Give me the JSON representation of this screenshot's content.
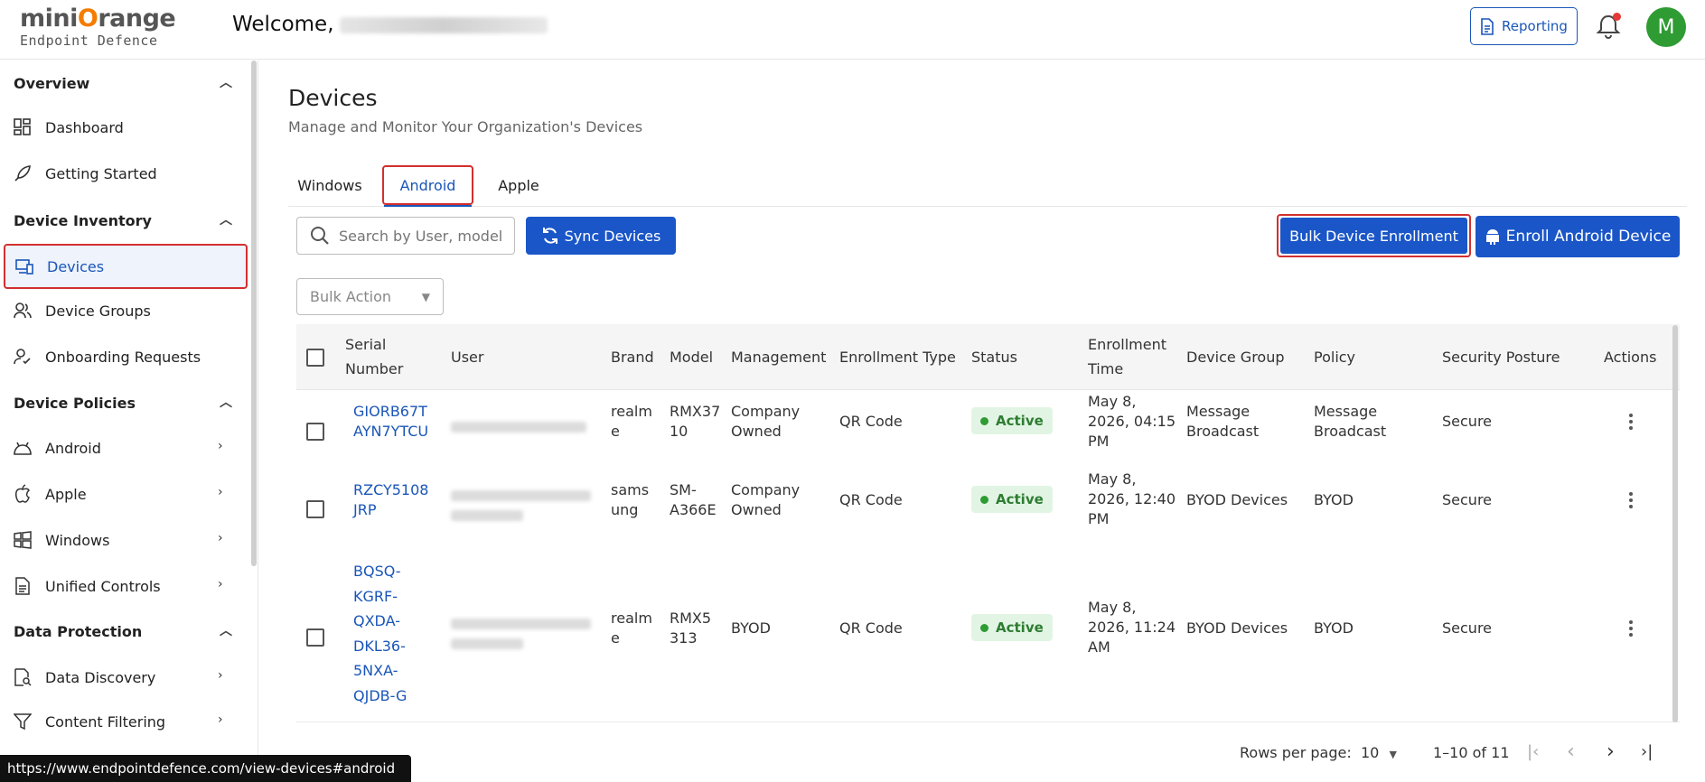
{
  "header": {
    "brand_main": "mini",
    "brand_o": "O",
    "brand_rest": "range",
    "brand_sub": "Endpoint Defence",
    "welcome": "Welcome,",
    "reporting": "Reporting",
    "avatar_letter": "M"
  },
  "sidebar": {
    "sections": [
      {
        "label": "Overview"
      },
      {
        "label": "Device Inventory"
      },
      {
        "label": "Device Policies"
      },
      {
        "label": "Data Protection"
      }
    ],
    "items": [
      {
        "label": "Dashboard",
        "icon": "dashboard-icon"
      },
      {
        "label": "Getting Started",
        "icon": "rocket-icon"
      },
      {
        "label": "Devices",
        "icon": "devices-icon"
      },
      {
        "label": "Device Groups",
        "icon": "group-icon"
      },
      {
        "label": "Onboarding Requests",
        "icon": "user-check-icon"
      },
      {
        "label": "Android",
        "icon": "android-icon"
      },
      {
        "label": "Apple",
        "icon": "apple-icon"
      },
      {
        "label": "Windows",
        "icon": "windows-icon"
      },
      {
        "label": "Unified Controls",
        "icon": "document-icon"
      },
      {
        "label": "Data Discovery",
        "icon": "data-discovery-icon"
      },
      {
        "label": "Content Filtering",
        "icon": "filter-icon"
      }
    ],
    "status_url": "https://www.endpointdefence.com/view-devices#android"
  },
  "page": {
    "title": "Devices",
    "subtitle": "Manage and Monitor Your Organization's Devices",
    "tabs": [
      {
        "label": "Windows"
      },
      {
        "label": "Android"
      },
      {
        "label": "Apple"
      }
    ],
    "search_placeholder": "Search by User, model a",
    "sync_label": "Sync Devices",
    "bulk_enroll_label": "Bulk Device Enrollment",
    "enroll_android_label": "Enroll Android Device",
    "bulk_action_label": "Bulk Action"
  },
  "table": {
    "headers": {
      "serial1": "Serial",
      "serial2": "Number",
      "user": "User",
      "brand": "Brand",
      "model": "Model",
      "management": "Management",
      "enrollment_type": "Enrollment Type",
      "status": "Status",
      "enroll_time1": "Enrollment",
      "enroll_time2": "Time",
      "device_group": "Device Group",
      "policy": "Policy",
      "security": "Security Posture",
      "actions": "Actions"
    },
    "rows": [
      {
        "serial": [
          "GIORB67T",
          "AYN7YTCU"
        ],
        "brand": [
          "realm",
          "e"
        ],
        "model": [
          "RMX37",
          "10"
        ],
        "management": [
          "Company",
          "Owned"
        ],
        "enrollment_type": "QR Code",
        "status": "Active",
        "time": [
          "May 8,",
          "2026, 04:15",
          "PM"
        ],
        "group": [
          "Message",
          "Broadcast"
        ],
        "policy": [
          "Message",
          "Broadcast"
        ],
        "security": "Secure"
      },
      {
        "serial": [
          "RZCY5108",
          "JRP"
        ],
        "brand": [
          "sams",
          "ung"
        ],
        "model": [
          "SM-",
          "A366E"
        ],
        "management": [
          "Company",
          "Owned"
        ],
        "enrollment_type": "QR Code",
        "status": "Active",
        "time": [
          "May 8,",
          "2026, 12:40",
          "PM"
        ],
        "group": [
          "BYOD Devices"
        ],
        "policy": [
          "BYOD"
        ],
        "security": "Secure"
      },
      {
        "serial": [
          "BQSQ-",
          "KGRF-",
          "QXDA-",
          "DKL36-",
          "5NXA-",
          "QJDB-G"
        ],
        "brand": [
          "realm",
          "e"
        ],
        "model": [
          "RMX5",
          "313"
        ],
        "management": [
          "BYOD"
        ],
        "enrollment_type": "QR Code",
        "status": "Active",
        "time": [
          "May 8,",
          "2026, 11:24",
          "AM"
        ],
        "group": [
          "BYOD Devices"
        ],
        "policy": [
          "BYOD"
        ],
        "security": "Secure"
      }
    ]
  },
  "footer": {
    "rows_per_page_label": "Rows per page:",
    "rows_per_page_value": "10",
    "range": "1–10 of 11"
  },
  "colors": {
    "primary": "#1a56c8",
    "highlight_border": "#d32f2f",
    "active_badge_bg": "#e2f5e4",
    "active_badge_text": "#2e7d32"
  }
}
